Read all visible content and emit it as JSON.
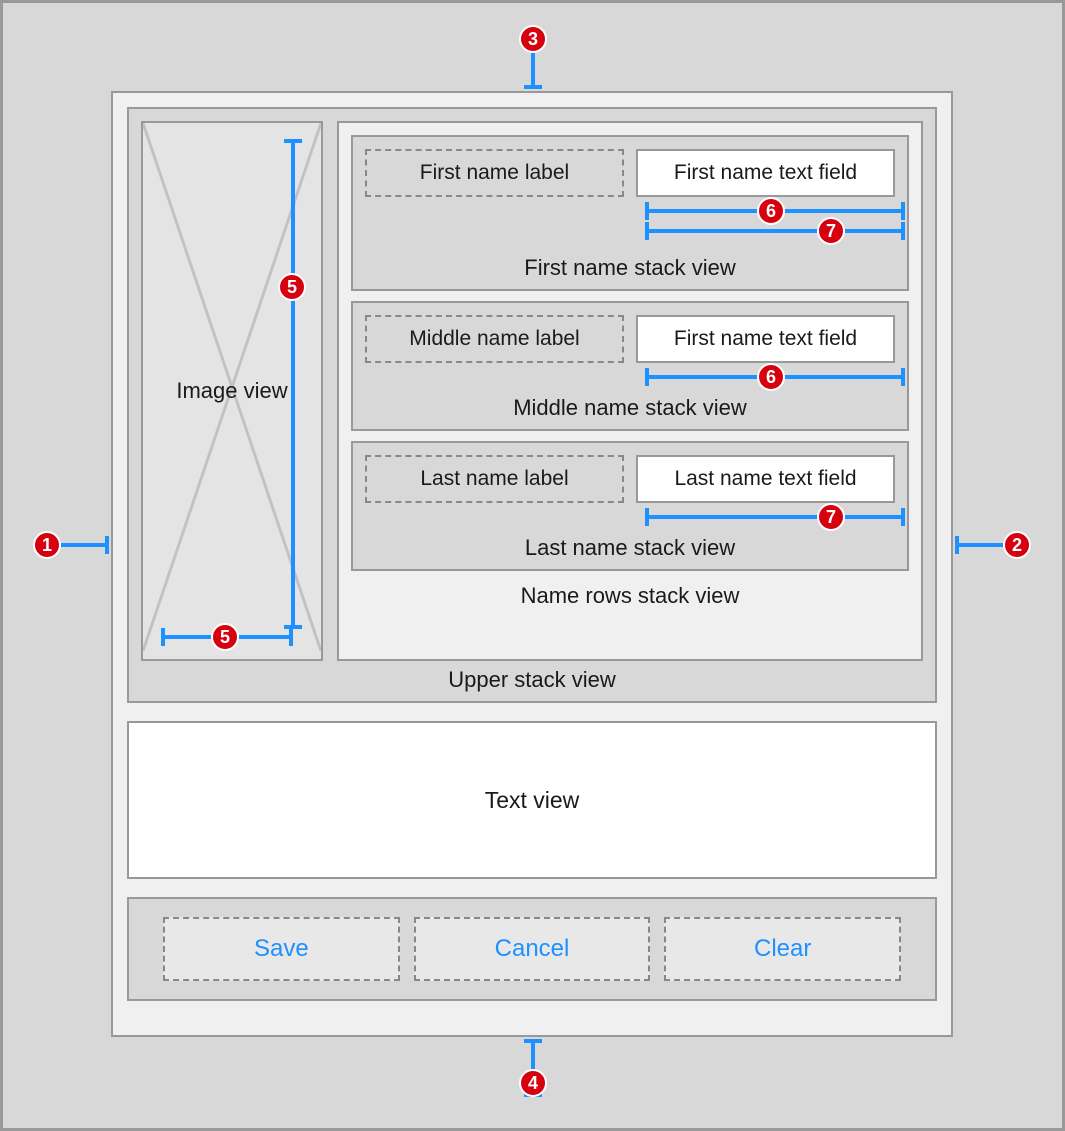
{
  "image_view": {
    "label": "Image view"
  },
  "name_rows": {
    "caption": "Name rows stack view",
    "rows": [
      {
        "label": "First name label",
        "field": "First name text field",
        "caption": "First name stack view"
      },
      {
        "label": "Middle name label",
        "field": "First name text field",
        "caption": "Middle name stack view"
      },
      {
        "label": "Last name label",
        "field": "Last name text field",
        "caption": "Last name stack view"
      }
    ]
  },
  "upper_stack": {
    "caption": "Upper stack view"
  },
  "text_view": {
    "label": "Text view"
  },
  "buttons": {
    "save": "Save",
    "cancel": "Cancel",
    "clear": "Clear"
  },
  "badges": {
    "b1": "1",
    "b2": "2",
    "b3": "3",
    "b4": "4",
    "b5": "5",
    "b6": "6",
    "b7": "7"
  }
}
